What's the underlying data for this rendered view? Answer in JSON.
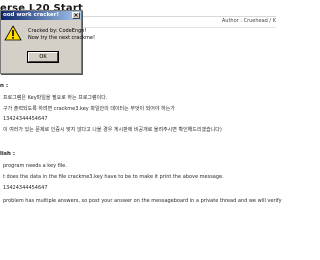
{
  "page": {
    "title": "erse L20 Start",
    "author": "Author : Cruehead / K"
  },
  "dialog": {
    "title": "ood work cracker!",
    "close_label": "×",
    "icon": "warning-icon",
    "message_line1": "Cracked by: CodeEngn!",
    "message_line2": "Now try the next crackme!",
    "ok_label": "OK"
  },
  "korean": {
    "heading": "n :",
    "lines": [
      "프로그램은 Key파일을 필요로 하는 프로그램이다.",
      "구가 출력되도록 하려면 crackme3.key 파일안의 데이터는 무엇이 되어야 하는가",
      "13424344454647",
      "이 여러가 있는 문제로 인증시 맞지 않다고 나올 경우 게시판에 비공개로 올려주시면 확인해드리겠습니다)"
    ]
  },
  "english": {
    "heading": "lish :",
    "lines": [
      "program needs a key file.",
      "t does the data in the file crackme3.key have to be to make it print the above message.",
      "13424344454647",
      "problem has multiple answers, so post your answer on the messageboard in a private thread and we will verify"
    ]
  },
  "colors": {
    "dialog_bg": "#d4d0c8",
    "titlebar_start": "#0a246a",
    "titlebar_end": "#a6caf0",
    "warning_yellow": "#ffde00"
  }
}
